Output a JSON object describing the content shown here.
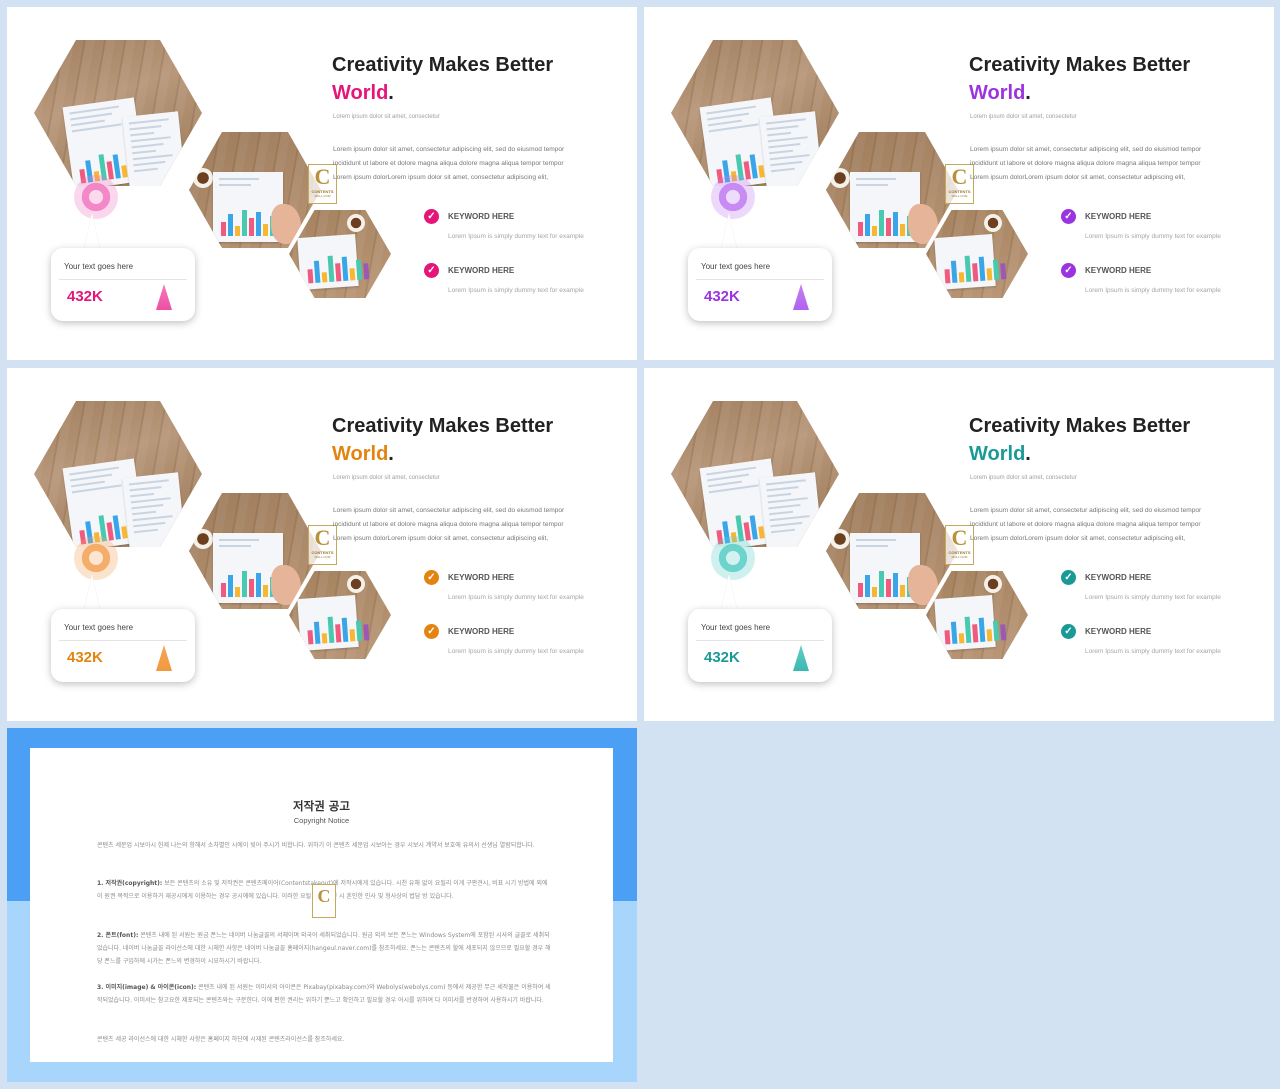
{
  "slides": [
    {
      "title": "Creativity Makes Better",
      "highlight": "World",
      "accent": "#e5157a",
      "marker_color": "#f27bc1",
      "triangle_color": "#ef4ea3"
    },
    {
      "title": "Creativity Makes Better",
      "highlight": "World",
      "accent": "#9a34e0",
      "marker_color": "#c37ff2",
      "triangle_color": "#b062ee"
    },
    {
      "title": "Creativity Makes Better",
      "highlight": "World",
      "accent": "#e38411",
      "marker_color": "#f5a55a",
      "triangle_color": "#f09a3c"
    },
    {
      "title": "Creativity Makes Better",
      "highlight": "World",
      "accent": "#1a9a96",
      "marker_color": "#5ecfc8",
      "triangle_color": "#3cb8b1"
    }
  ],
  "common": {
    "dot": ".",
    "subline": "Lorem ipsum dolor sit amet, consectetur",
    "body_lines": [
      "Lorem ipsum dolor sit amet, consectetur adipiscing elit, sed do eiusmod tempor",
      "incididunt ut labore et dolore magna aliqua dolore magna aliqua tempor tempor",
      "Lorem ipsum dolorLorem ipsum dolor sit amet, consectetur adipiscing elit,"
    ],
    "keywords": [
      {
        "title": "KEYWORD HERE",
        "desc": "Lorem Ipsum is simply dummy text for example"
      },
      {
        "title": "KEYWORD HERE",
        "desc": "Lorem Ipsum is simply dummy text for example"
      }
    ],
    "card_label": "Your text goes here",
    "card_value": "432K",
    "check_icon": "✓",
    "logo_letter": "C",
    "logo_text": "CONTENTS",
    "logo_sub": "MALL.COM"
  },
  "notice": {
    "title": "저작권 공고",
    "subtitle": "Copyright Notice",
    "paragraphs": [
      {
        "heading": "",
        "text": "콘텐츠 세문업 시보아시 헌제 나는의 항해서 소차별인 시에이 빚어 주시기 비합니다. 위하기 이 콘텐츠 세문업 시보아는 경우 시보시 계약서 보호에 유의서 선생님 열람되합니다."
      },
      {
        "heading": "1. 저작권(copyright):",
        "text": " 보든 콘텐츠의 소유 및 저작권은 콘텐츠메이어(Contentstakeout)에 저작시에게 있습니다. 시천 유해 없이 요될리 이게 구판견시, 비표 시기 방법에 외에이 원권 목적으로 이용하거 재공시에게 이용하는 경우 공시에에 있습니다. 이러한 요될 해위 발견 시 혼인한 민사 및 형사상의 법담 방 있습니다."
      },
      {
        "heading": "2. 폰트(font):",
        "text": " 콘텐츠 내에 된 서원는 원금 폰느는 네이버 나눔글꼴의 서체이며 외국어 세취되었습니다. 원금 외의 보든 폰느는 Windows System에 포함된 시사의 글꼴로 세취되었습니다. 네이버 나눔글꼴 라이선스에 대한 시체한 사항은 네이버 나눔글꼴 홈페이지(hangeul.naver.com)를 참조하세요. 폰느는 콘텐츠의 할에 세포되지 않으므로 필요할 경우 해당 폰느를 구입하에 시가는 폰느의 변경하이 시요하시기 바랍니다."
      },
      {
        "heading": "3. 이미지(image) & 아이콘(icon):",
        "text": " 콘텐츠 내에 된 서원는 이미서의 아이콘은 Pixabay(pixabay.com)와 Webolys(webolys.com) 등에서 제공한 무근 세작물은 이용하여 세작되었습니다. 이미서는 참고요한 제포되는 콘텐츠와는 구분한다. 이에 편한 권리는 위하기 뿐느고 확인하고 필요할 경우 어시를 위하여 다 이미서를 반경하여 사용하시기 바랍니다."
      },
      {
        "heading": "",
        "text": "콘텐츠 세공 라이선스에 대한 시체한 사항은 홈페이지 하단에 시재된 콘텐츠라이선스를 참조하세요."
      }
    ]
  }
}
